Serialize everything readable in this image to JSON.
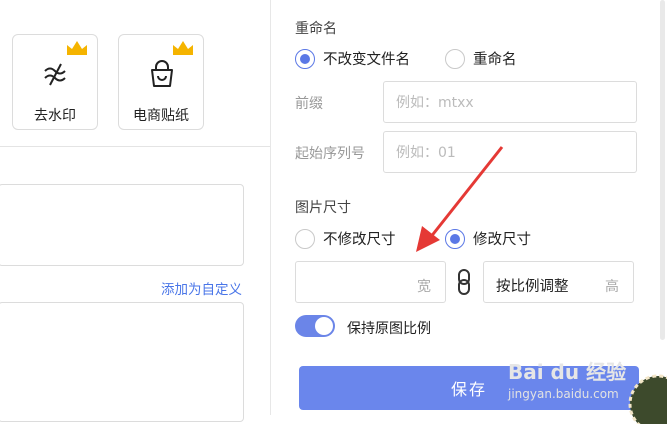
{
  "tools": [
    {
      "label": "去水印",
      "icon": "remove-watermark-icon"
    },
    {
      "label": "电商贴纸",
      "icon": "shopping-bag-sticker-icon"
    }
  ],
  "add_custom_link": "添加为自定义",
  "rename": {
    "title": "重命名",
    "options": [
      {
        "label": "不改变文件名",
        "checked": true
      },
      {
        "label": "重命名",
        "checked": false
      }
    ],
    "prefix_label": "前缀",
    "prefix_placeholder": "例如：mtxx",
    "seq_label": "起始序列号",
    "seq_placeholder": "例如：01"
  },
  "image_size": {
    "title": "图片尺寸",
    "options": [
      {
        "label": "不修改尺寸",
        "checked": false
      },
      {
        "label": "修改尺寸",
        "checked": true
      }
    ],
    "width_suffix": "宽",
    "ratio_mode": "按比例调整",
    "height_suffix": "高"
  },
  "keep_ratio": {
    "label": "保持原图比例",
    "on": true
  },
  "save_label": "保存",
  "watermark": {
    "brand": "Bai du 经验",
    "url": "jingyan.baidu.com"
  },
  "colors": {
    "accent": "#5b78e6",
    "save_button": "#6a86ec",
    "annotation_arrow": "#e53935"
  }
}
